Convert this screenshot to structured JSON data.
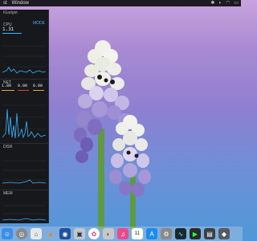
{
  "menubar": {
    "app_fragment": "st",
    "window_menu": "Window"
  },
  "widget": {
    "title_fragment": "tGadget",
    "sections": [
      {
        "title": "CPU",
        "button": "MODE",
        "value": "1.31"
      },
      {
        "title": "NET",
        "value_left": "1.89",
        "value_mid": "0.00",
        "value_right": "0.00"
      },
      {
        "title": "DISK"
      },
      {
        "title": "MEM"
      }
    ]
  },
  "dock": {
    "icons": [
      "finder-icon",
      "launchpad-icon",
      "safari-icon",
      "vlc-icon",
      "mail-icon",
      "photos-icon",
      "photos-app-icon",
      "music-icon",
      "calendar-icon",
      "app-store-icon",
      "system-prefs-icon",
      "activity-icon",
      "terminal-icon",
      "other-icon"
    ],
    "calendar_day": "11"
  },
  "colors": {
    "accent": "#5aa8ff",
    "cpu_line": "#38b6ff",
    "net_orange": "#f0a030",
    "net_red": "#e04040"
  }
}
